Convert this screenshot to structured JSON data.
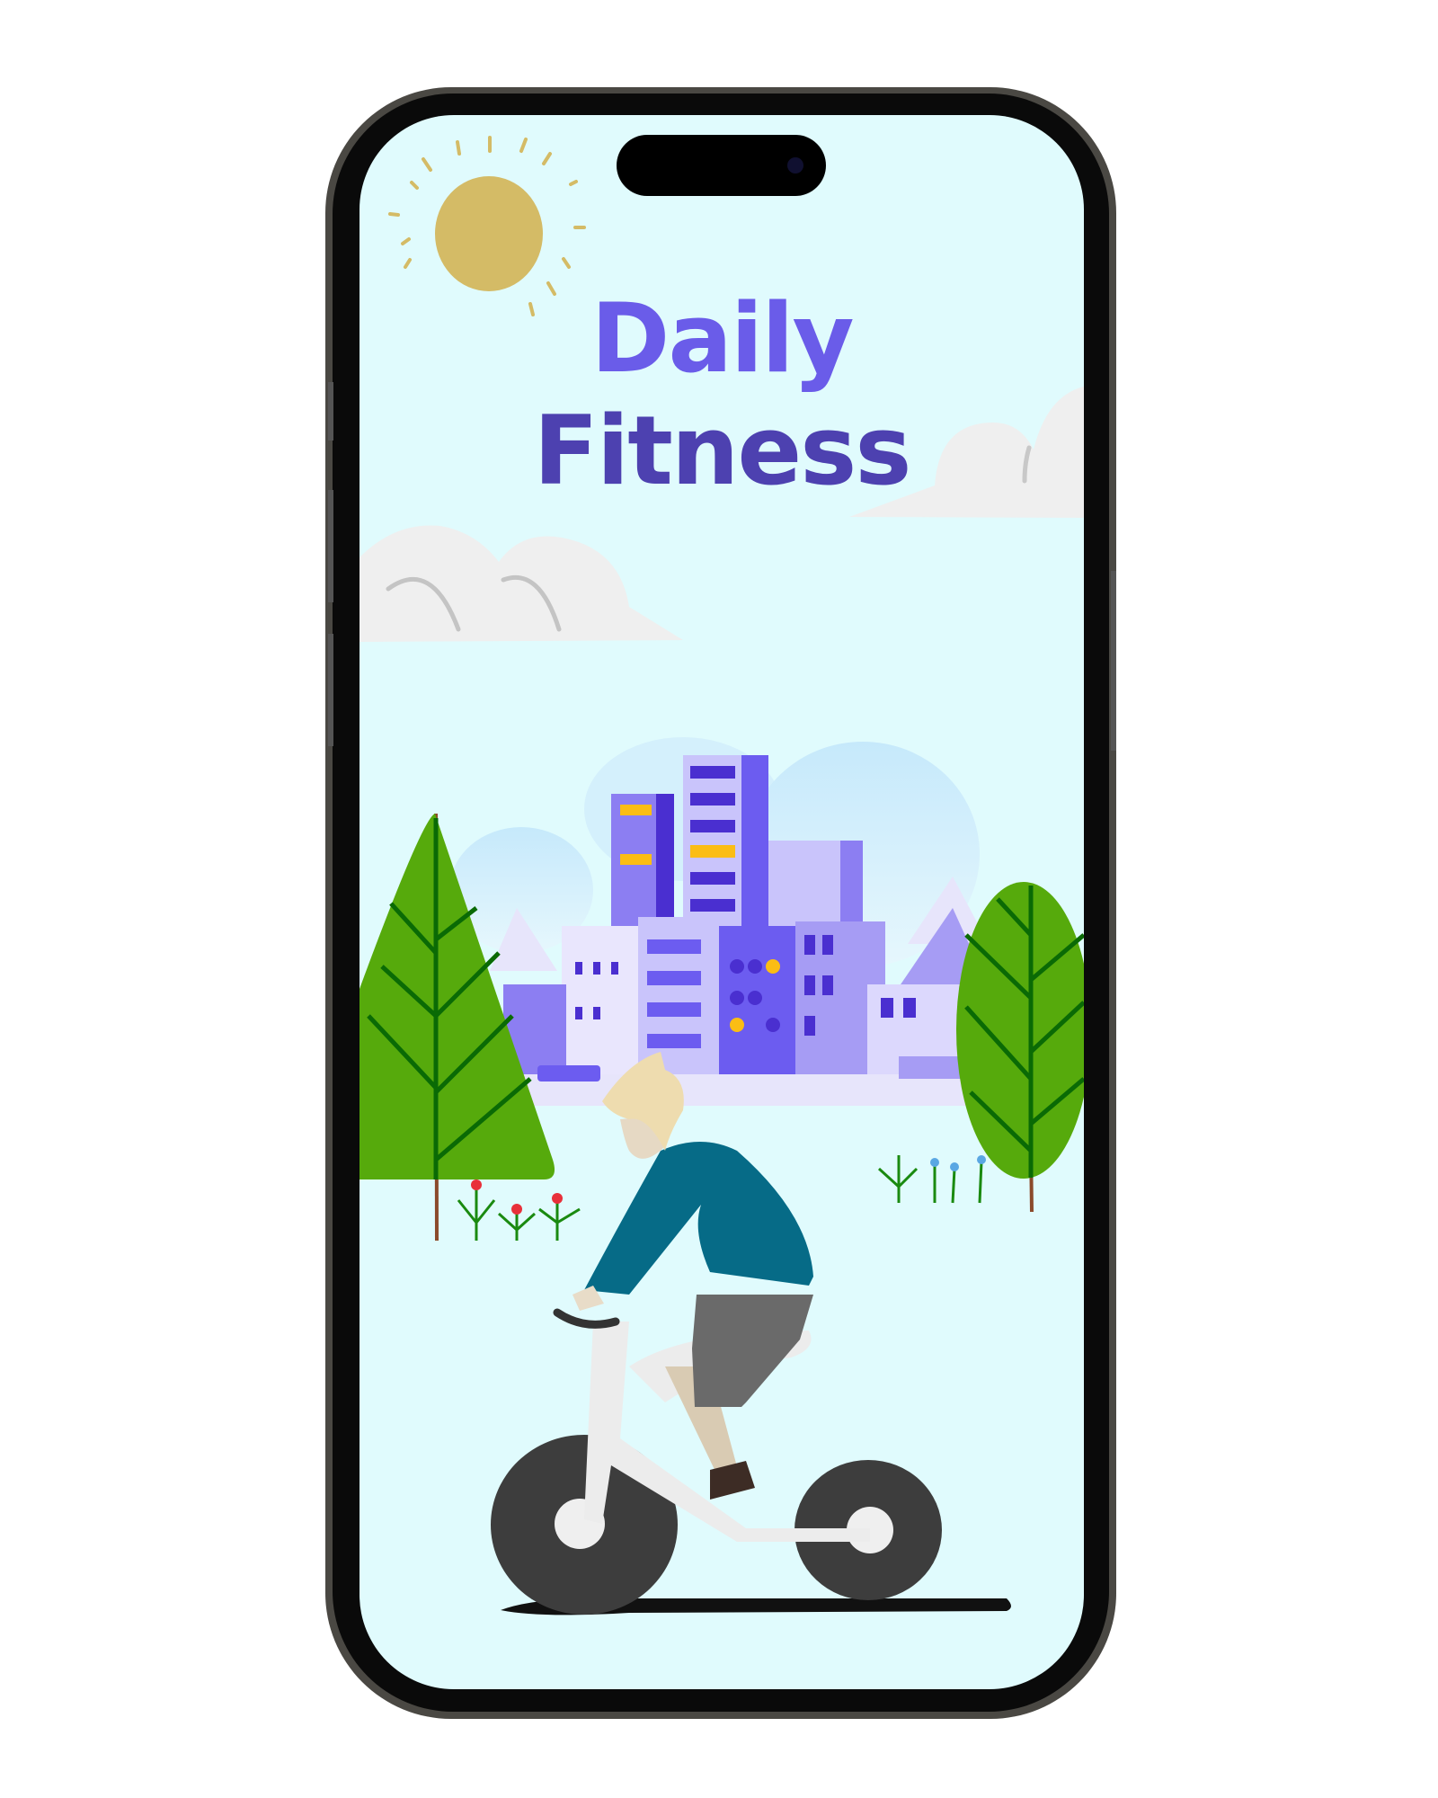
{
  "app": {
    "title_line1": "Daily",
    "title_line2": "Fitness"
  },
  "colors": {
    "screen_bg": "#e0fbfd",
    "title_top": "#6a5ce9",
    "title_bottom": "#4d41b0",
    "sun": "#d4bb66",
    "tree": "#56aa0c",
    "building": "#6c5cf0",
    "shirt": "#066b87"
  }
}
